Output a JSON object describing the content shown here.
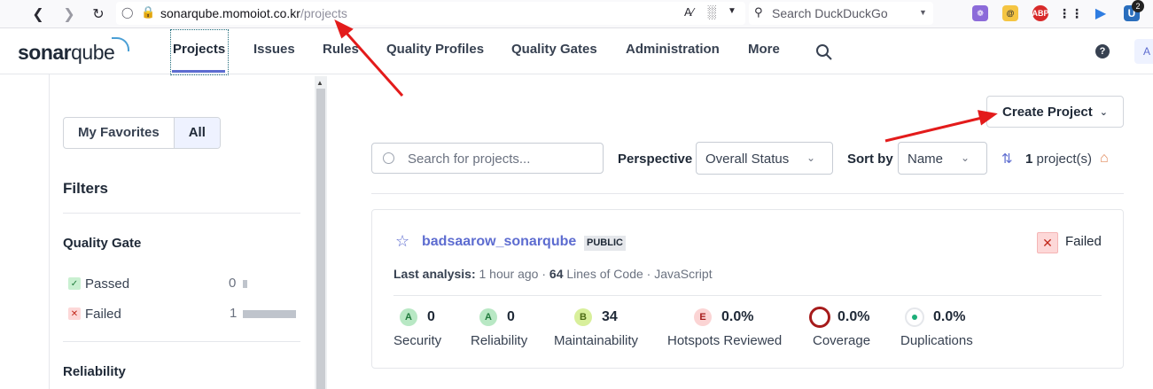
{
  "browser": {
    "url_host": "sonarqube.momoiot.co.kr",
    "url_path": "/projects",
    "search_placeholder": "Search DuckDuckGo",
    "badge_count": "2"
  },
  "header": {
    "logo_prefix": "sonar",
    "logo_suffix": "qube",
    "nav": [
      "Projects",
      "Issues",
      "Rules",
      "Quality Profiles",
      "Quality Gates",
      "Administration",
      "More"
    ],
    "help": "?",
    "avatar": "A"
  },
  "sidebar": {
    "favorites_label": "My Favorites",
    "all_label": "All",
    "filters_title": "Filters",
    "quality_gate_title": "Quality Gate",
    "passed_label": "Passed",
    "passed_count": "0",
    "failed_label": "Failed",
    "failed_count": "1",
    "reliability_title": "Reliability"
  },
  "main": {
    "create_label": "Create Project",
    "search_placeholder": "Search for projects...",
    "perspective_label": "Perspective",
    "perspective_value": "Overall Status",
    "sortby_label": "Sort by",
    "sortby_value": "Name",
    "count_number": "1",
    "count_suffix": "project(s)"
  },
  "project": {
    "name": "badsaarow_sonarqube",
    "visibility": "PUBLIC",
    "status": "Failed",
    "last_analysis_label": "Last analysis:",
    "last_analysis_value": "1 hour ago",
    "loc_number": "64",
    "loc_label": "Lines of Code",
    "language": "JavaScript",
    "metrics": {
      "security": {
        "rating": "A",
        "value": "0",
        "label": "Security"
      },
      "reliability": {
        "rating": "A",
        "value": "0",
        "label": "Reliability"
      },
      "maintainability": {
        "rating": "B",
        "value": "34",
        "label": "Maintainability"
      },
      "hotspots": {
        "rating": "E",
        "value": "0.0%",
        "label": "Hotspots Reviewed"
      },
      "coverage": {
        "value": "0.0%",
        "label": "Coverage"
      },
      "duplications": {
        "value": "0.0%",
        "label": "Duplications"
      }
    }
  },
  "colors": {
    "accent": "#5d6cd0",
    "rating_a": "#b8e8c4",
    "rating_b": "#d8ef9b",
    "rating_e": "#fbd4d4",
    "fail_red": "#c2281b",
    "annotation_arrow": "#e31b1b"
  }
}
